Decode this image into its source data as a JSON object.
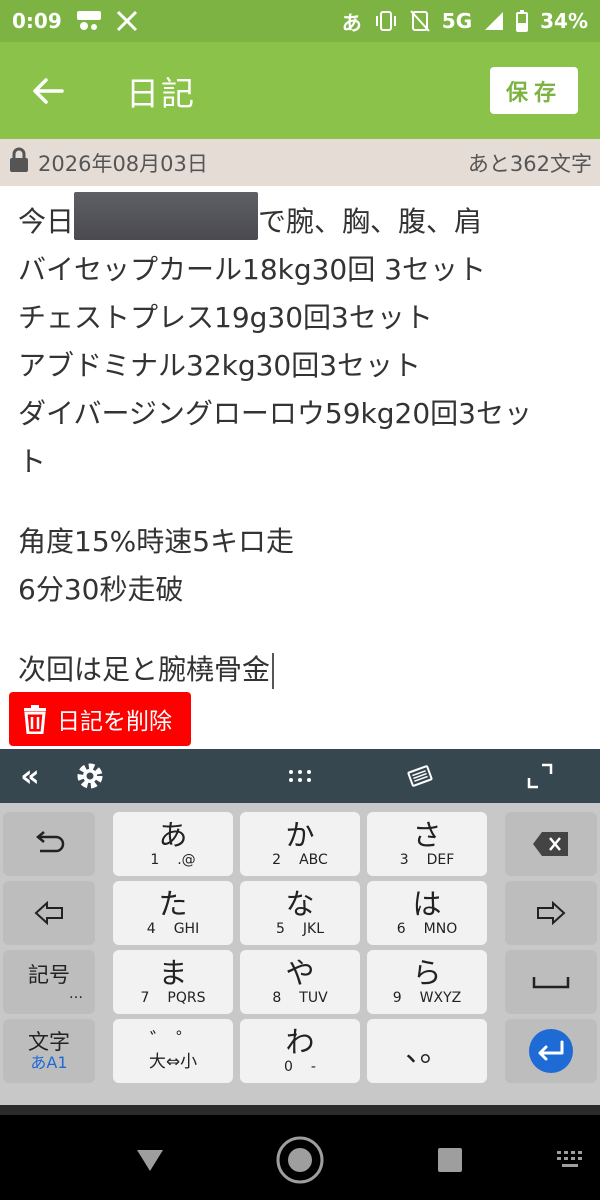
{
  "status_bar": {
    "time": "0:09",
    "left_icons": [
      "news-app-icon",
      "x-icon"
    ],
    "ime_indicator": "あ",
    "network": "5G",
    "battery": "34%"
  },
  "app_bar": {
    "title": "日記",
    "save_label": "保存"
  },
  "info_bar": {
    "date": "2026年08月03日",
    "remaining": "あと362文字"
  },
  "diary": {
    "line1_prefix": "今日",
    "line1_suffix": "で腕、胸、腹、肩",
    "line2": "バイセップカール18kg30回 3セット",
    "line3": "チェストプレス19g30回3セット",
    "line4": "アブドミナル32kg30回3セット",
    "line5": "ダイバージングローロウ59kg20回3セッ",
    "line6": "ト",
    "line7": "角度15%時速5キロ走",
    "line8": "6分30秒走破",
    "line9": "次回は足と腕橈骨金"
  },
  "delete_label": "日記を削除",
  "keyboard": {
    "keys": {
      "a": {
        "main": "あ",
        "num": "1",
        "alt": ".@"
      },
      "ka": {
        "main": "か",
        "num": "2",
        "alt": "ABC"
      },
      "sa": {
        "main": "さ",
        "num": "3",
        "alt": "DEF"
      },
      "ta": {
        "main": "た",
        "num": "4",
        "alt": "GHI"
      },
      "na": {
        "main": "な",
        "num": "5",
        "alt": "JKL"
      },
      "ha": {
        "main": "は",
        "num": "6",
        "alt": "MNO"
      },
      "ma": {
        "main": "ま",
        "num": "7",
        "alt": "PQRS"
      },
      "ya": {
        "main": "や",
        "num": "8",
        "alt": "TUV"
      },
      "ra": {
        "main": "ら",
        "num": "9",
        "alt": "WXYZ"
      },
      "dakuten": {
        "main": "゛ ゜",
        "sub": "大⇔小"
      },
      "wa": {
        "main": "わ",
        "num": "0",
        "alt": "-"
      },
      "punct": {
        "main": "、。"
      }
    },
    "symbol_label": "記号",
    "symbol_hint": "…",
    "mode_label": "文字",
    "mode_hint": "あA1"
  },
  "colors": {
    "app_bar": "#8bc34a",
    "status_bar": "#7cb342",
    "delete": "#ff0000",
    "enter": "#1e6bd6"
  }
}
